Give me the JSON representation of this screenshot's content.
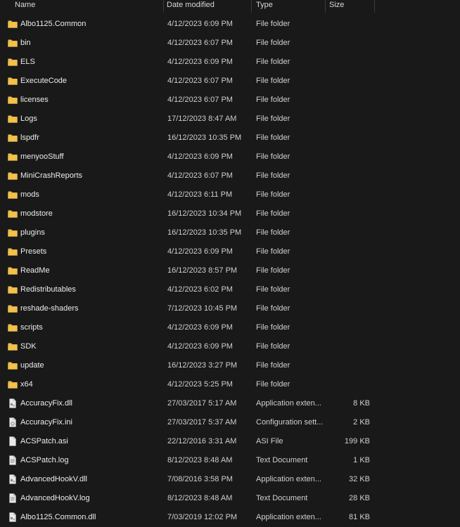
{
  "columns": {
    "name": "Name",
    "date": "Date modified",
    "type": "Type",
    "size": "Size"
  },
  "colors": {
    "background": "#191919",
    "folder": "#f2c14e",
    "file": "#e9e9e9",
    "text": "#e6e6e6"
  },
  "rows": [
    {
      "name": "Albo1125.Common",
      "date": "4/12/2023 6:09 PM",
      "type": "File folder",
      "size": "",
      "icon": "folder-icon"
    },
    {
      "name": "bin",
      "date": "4/12/2023 6:07 PM",
      "type": "File folder",
      "size": "",
      "icon": "folder-icon"
    },
    {
      "name": "ELS",
      "date": "4/12/2023 6:09 PM",
      "type": "File folder",
      "size": "",
      "icon": "folder-icon"
    },
    {
      "name": "ExecuteCode",
      "date": "4/12/2023 6:07 PM",
      "type": "File folder",
      "size": "",
      "icon": "folder-icon"
    },
    {
      "name": "licenses",
      "date": "4/12/2023 6:07 PM",
      "type": "File folder",
      "size": "",
      "icon": "folder-icon"
    },
    {
      "name": "Logs",
      "date": "17/12/2023 8:47 AM",
      "type": "File folder",
      "size": "",
      "icon": "folder-icon"
    },
    {
      "name": "lspdfr",
      "date": "16/12/2023 10:35 PM",
      "type": "File folder",
      "size": "",
      "icon": "folder-icon"
    },
    {
      "name": "menyooStuff",
      "date": "4/12/2023 6:09 PM",
      "type": "File folder",
      "size": "",
      "icon": "folder-icon"
    },
    {
      "name": "MiniCrashReports",
      "date": "4/12/2023 6:07 PM",
      "type": "File folder",
      "size": "",
      "icon": "folder-icon"
    },
    {
      "name": "mods",
      "date": "4/12/2023 6:11 PM",
      "type": "File folder",
      "size": "",
      "icon": "folder-icon"
    },
    {
      "name": "modstore",
      "date": "16/12/2023 10:34 PM",
      "type": "File folder",
      "size": "",
      "icon": "folder-icon"
    },
    {
      "name": "plugins",
      "date": "16/12/2023 10:35 PM",
      "type": "File folder",
      "size": "",
      "icon": "folder-icon"
    },
    {
      "name": "Presets",
      "date": "4/12/2023 6:09 PM",
      "type": "File folder",
      "size": "",
      "icon": "folder-icon"
    },
    {
      "name": "ReadMe",
      "date": "16/12/2023 8:57 PM",
      "type": "File folder",
      "size": "",
      "icon": "folder-icon"
    },
    {
      "name": "Redistributables",
      "date": "4/12/2023 6:02 PM",
      "type": "File folder",
      "size": "",
      "icon": "folder-icon"
    },
    {
      "name": "reshade-shaders",
      "date": "7/12/2023 10:45 PM",
      "type": "File folder",
      "size": "",
      "icon": "folder-icon"
    },
    {
      "name": "scripts",
      "date": "4/12/2023 6:09 PM",
      "type": "File folder",
      "size": "",
      "icon": "folder-icon"
    },
    {
      "name": "SDK",
      "date": "4/12/2023 6:09 PM",
      "type": "File folder",
      "size": "",
      "icon": "folder-icon"
    },
    {
      "name": "update",
      "date": "16/12/2023 3:27 PM",
      "type": "File folder",
      "size": "",
      "icon": "folder-icon"
    },
    {
      "name": "x64",
      "date": "4/12/2023 5:25 PM",
      "type": "File folder",
      "size": "",
      "icon": "folder-icon"
    },
    {
      "name": "AccuracyFix.dll",
      "date": "27/03/2017 5:17 AM",
      "type": "Application exten...",
      "size": "8 KB",
      "icon": "dll-file-icon"
    },
    {
      "name": "AccuracyFix.ini",
      "date": "27/03/2017 5:37 AM",
      "type": "Configuration sett...",
      "size": "2 KB",
      "icon": "config-file-icon"
    },
    {
      "name": "ACSPatch.asi",
      "date": "22/12/2016 3:31 AM",
      "type": "ASI File",
      "size": "199 KB",
      "icon": "file-icon"
    },
    {
      "name": "ACSPatch.log",
      "date": "8/12/2023 8:48 AM",
      "type": "Text Document",
      "size": "1 KB",
      "icon": "text-file-icon"
    },
    {
      "name": "AdvancedHookV.dll",
      "date": "7/08/2016 3:58 PM",
      "type": "Application exten...",
      "size": "32 KB",
      "icon": "dll-file-icon"
    },
    {
      "name": "AdvancedHookV.log",
      "date": "8/12/2023 8:48 AM",
      "type": "Text Document",
      "size": "28 KB",
      "icon": "text-file-icon"
    },
    {
      "name": "Albo1125.Common.dll",
      "date": "7/03/2019 12:02 PM",
      "type": "Application exten...",
      "size": "81 KB",
      "icon": "dll-file-icon"
    }
  ]
}
